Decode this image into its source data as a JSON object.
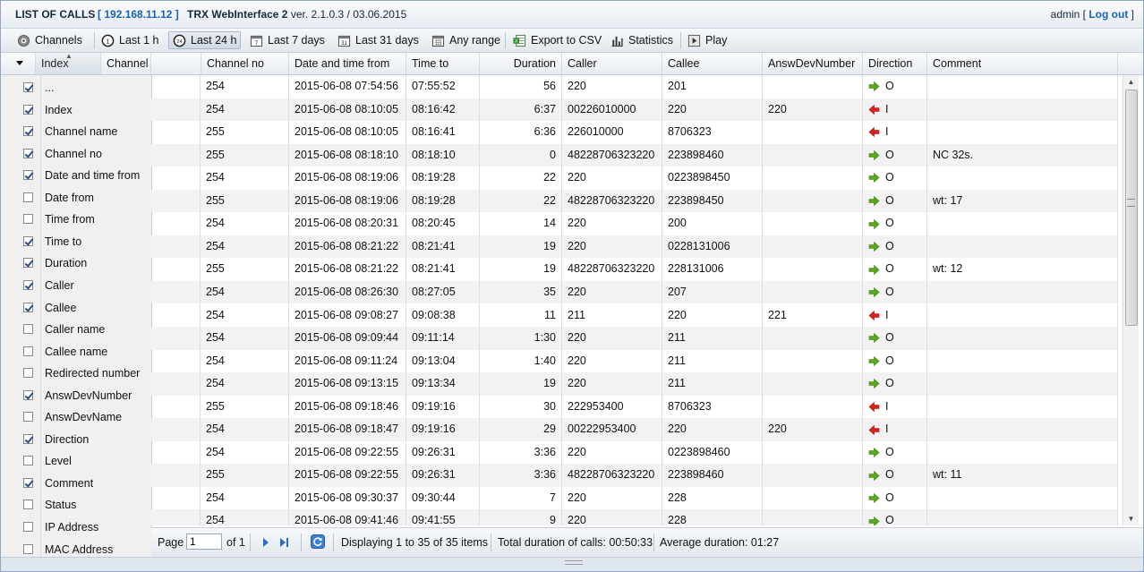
{
  "header": {
    "title": "LIST OF CALLS",
    "ip": "192.168.11.12",
    "app_name": "TRX WebInterface 2",
    "version": "ver. 2.1.0.3 / 03.06.2015",
    "user": "admin",
    "logout": "Log out"
  },
  "toolbar": {
    "channels": "Channels",
    "last1h": "Last 1 h",
    "last24h": "Last 24 h",
    "last7d": "Last 7 days",
    "last31d": "Last 31 days",
    "any_range": "Any range",
    "export_csv": "Export to CSV",
    "statistics": "Statistics",
    "play": "Play"
  },
  "columns": {
    "index": "Index",
    "channel_name": "Channel name",
    "channel_no": "Channel no",
    "date_from": "Date and time from",
    "time_to": "Time to",
    "duration": "Duration",
    "caller": "Caller",
    "callee": "Callee",
    "answ": "AnswDevNumber",
    "direction": "Direction",
    "comment": "Comment"
  },
  "column_menu": [
    {
      "label": "...",
      "checked": true
    },
    {
      "label": "Index",
      "checked": true
    },
    {
      "label": "Channel name",
      "checked": true
    },
    {
      "label": "Channel no",
      "checked": true
    },
    {
      "label": "Date and time from",
      "checked": true
    },
    {
      "label": "Date from",
      "checked": false
    },
    {
      "label": "Time from",
      "checked": false
    },
    {
      "label": "Time to",
      "checked": true
    },
    {
      "label": "Duration",
      "checked": true
    },
    {
      "label": "Caller",
      "checked": true
    },
    {
      "label": "Callee",
      "checked": true
    },
    {
      "label": "Caller name",
      "checked": false
    },
    {
      "label": "Callee name",
      "checked": false
    },
    {
      "label": "Redirected number",
      "checked": false
    },
    {
      "label": "AnswDevNumber",
      "checked": true
    },
    {
      "label": "AnswDevName",
      "checked": false
    },
    {
      "label": "Direction",
      "checked": true
    },
    {
      "label": "Level",
      "checked": false
    },
    {
      "label": "Comment",
      "checked": true
    },
    {
      "label": "Status",
      "checked": false
    },
    {
      "label": "IP Address",
      "checked": false
    },
    {
      "label": "MAC Address",
      "checked": false
    }
  ],
  "rows": [
    {
      "ch": "254",
      "from": "2015-06-08 07:54:56",
      "to": "07:55:52",
      "dur": "56",
      "caller": "220",
      "callee": "201",
      "answ": "",
      "dir": "out",
      "dir_label": "O",
      "comment": ""
    },
    {
      "ch": "254",
      "from": "2015-06-08 08:10:05",
      "to": "08:16:42",
      "dur": "6:37",
      "caller": "00226010000",
      "callee": "220",
      "answ": "220",
      "dir": "in",
      "dir_label": "I",
      "comment": ""
    },
    {
      "ch": "255",
      "from": "2015-06-08 08:10:05",
      "to": "08:16:41",
      "dur": "6:36",
      "caller": "226010000",
      "callee": "8706323",
      "answ": "",
      "dir": "in",
      "dir_label": "I",
      "comment": ""
    },
    {
      "ch": "255",
      "from": "2015-06-08 08:18:10",
      "to": "08:18:10",
      "dur": "0",
      "caller": "48228706323220",
      "callee": "223898460",
      "answ": "",
      "dir": "out",
      "dir_label": "O",
      "comment": "NC 32s."
    },
    {
      "ch": "254",
      "from": "2015-06-08 08:19:06",
      "to": "08:19:28",
      "dur": "22",
      "caller": "220",
      "callee": "0223898450",
      "answ": "",
      "dir": "out",
      "dir_label": "O",
      "comment": ""
    },
    {
      "ch": "255",
      "from": "2015-06-08 08:19:06",
      "to": "08:19:28",
      "dur": "22",
      "caller": "48228706323220",
      "callee": "223898450",
      "answ": "",
      "dir": "out",
      "dir_label": "O",
      "comment": "wt: 17"
    },
    {
      "ch": "254",
      "from": "2015-06-08 08:20:31",
      "to": "08:20:45",
      "dur": "14",
      "caller": "220",
      "callee": "200",
      "answ": "",
      "dir": "out",
      "dir_label": "O",
      "comment": ""
    },
    {
      "ch": "254",
      "from": "2015-06-08 08:21:22",
      "to": "08:21:41",
      "dur": "19",
      "caller": "220",
      "callee": "0228131006",
      "answ": "",
      "dir": "out",
      "dir_label": "O",
      "comment": ""
    },
    {
      "ch": "255",
      "from": "2015-06-08 08:21:22",
      "to": "08:21:41",
      "dur": "19",
      "caller": "48228706323220",
      "callee": "228131006",
      "answ": "",
      "dir": "out",
      "dir_label": "O",
      "comment": "wt: 12"
    },
    {
      "ch": "254",
      "from": "2015-06-08 08:26:30",
      "to": "08:27:05",
      "dur": "35",
      "caller": "220",
      "callee": "207",
      "answ": "",
      "dir": "out",
      "dir_label": "O",
      "comment": ""
    },
    {
      "ch": "254",
      "from": "2015-06-08 09:08:27",
      "to": "09:08:38",
      "dur": "11",
      "caller": "211",
      "callee": "220",
      "answ": "221",
      "dir": "in",
      "dir_label": "I",
      "comment": ""
    },
    {
      "ch": "254",
      "from": "2015-06-08 09:09:44",
      "to": "09:11:14",
      "dur": "1:30",
      "caller": "220",
      "callee": "211",
      "answ": "",
      "dir": "out",
      "dir_label": "O",
      "comment": ""
    },
    {
      "ch": "254",
      "from": "2015-06-08 09:11:24",
      "to": "09:13:04",
      "dur": "1:40",
      "caller": "220",
      "callee": "211",
      "answ": "",
      "dir": "out",
      "dir_label": "O",
      "comment": ""
    },
    {
      "ch": "254",
      "from": "2015-06-08 09:13:15",
      "to": "09:13:34",
      "dur": "19",
      "caller": "220",
      "callee": "211",
      "answ": "",
      "dir": "out",
      "dir_label": "O",
      "comment": ""
    },
    {
      "ch": "255",
      "from": "2015-06-08 09:18:46",
      "to": "09:19:16",
      "dur": "30",
      "caller": "222953400",
      "callee": "8706323",
      "answ": "",
      "dir": "in",
      "dir_label": "I",
      "comment": ""
    },
    {
      "ch": "254",
      "from": "2015-06-08 09:18:47",
      "to": "09:19:16",
      "dur": "29",
      "caller": "00222953400",
      "callee": "220",
      "answ": "220",
      "dir": "in",
      "dir_label": "I",
      "comment": ""
    },
    {
      "ch": "254",
      "from": "2015-06-08 09:22:55",
      "to": "09:26:31",
      "dur": "3:36",
      "caller": "220",
      "callee": "0223898460",
      "answ": "",
      "dir": "out",
      "dir_label": "O",
      "comment": ""
    },
    {
      "ch": "255",
      "from": "2015-06-08 09:22:55",
      "to": "09:26:31",
      "dur": "3:36",
      "caller": "48228706323220",
      "callee": "223898460",
      "answ": "",
      "dir": "out",
      "dir_label": "O",
      "comment": "wt: 11"
    },
    {
      "ch": "254",
      "from": "2015-06-08 09:30:37",
      "to": "09:30:44",
      "dur": "7",
      "caller": "220",
      "callee": "228",
      "answ": "",
      "dir": "out",
      "dir_label": "O",
      "comment": ""
    },
    {
      "ch": "254",
      "from": "2015-06-08 09:41:46",
      "to": "09:41:55",
      "dur": "9",
      "caller": "220",
      "callee": "228",
      "answ": "",
      "dir": "out",
      "dir_label": "O",
      "comment": ""
    }
  ],
  "pager": {
    "page_label": "Page",
    "page_value": "1",
    "of_label": "of 1",
    "displaying": "Displaying 1 to 35 of 35 items",
    "total": "Total duration of calls: 00:50:33",
    "average": "Average duration: 01:27"
  },
  "colors": {
    "accent": "#1a63b8",
    "arrow_out": "#58a81e",
    "arrow_in": "#d8221a"
  }
}
